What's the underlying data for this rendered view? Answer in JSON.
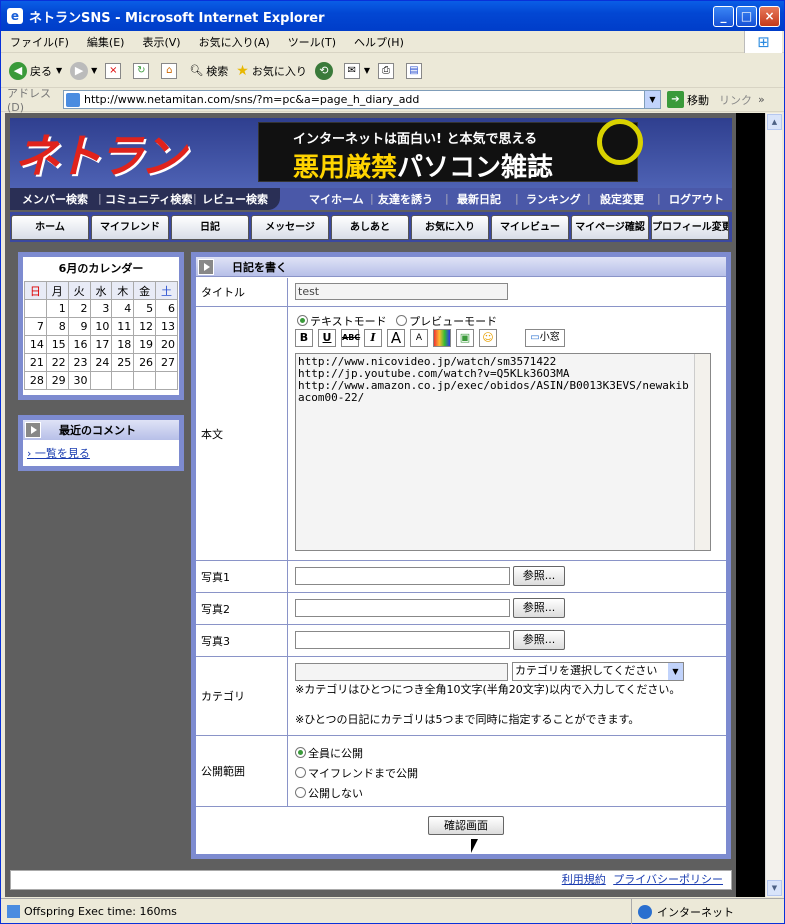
{
  "window": {
    "title": "ネトランSNS - Microsoft Internet Explorer"
  },
  "menu": [
    "ファイル(F)",
    "編集(E)",
    "表示(V)",
    "お気に入り(A)",
    "ツール(T)",
    "ヘルプ(H)"
  ],
  "toolbar": {
    "back": "戻る",
    "search": "検索",
    "favorites": "お気に入り"
  },
  "address": {
    "label": "アドレス(D)",
    "url": "http://www.netamitan.com/sns/?m=pc&a=page_h_diary_add",
    "go": "移動",
    "links": "リンク"
  },
  "site": {
    "logo": "ネトラン",
    "banner_line1": "インターネットは面白い! と本気で思える",
    "banner_line2a": "悪用厳禁",
    "banner_line2b": "パソコン雑誌"
  },
  "nav": {
    "left": [
      "メンバー検索",
      "コミュニティ検索",
      "レビュー検索"
    ],
    "right": [
      "マイホーム",
      "友達を誘う",
      "最新日記",
      "ランキング",
      "設定変更",
      "ログアウト"
    ]
  },
  "tabs": [
    "ホーム",
    "マイフレンド",
    "日記",
    "メッセージ",
    "あしあと",
    "お気に入り",
    "マイレビュー",
    "マイページ確認",
    "プロフィール変更"
  ],
  "calendar": {
    "title": "6月のカレンダー",
    "weekdays": [
      "日",
      "月",
      "火",
      "水",
      "木",
      "金",
      "土"
    ],
    "weeks": [
      [
        "",
        "1",
        "2",
        "3",
        "4",
        "5",
        "6",
        "7"
      ],
      [
        "8",
        "9",
        "10",
        "11",
        "12",
        "13",
        "14"
      ],
      [
        "15",
        "16",
        "17",
        "18",
        "19",
        "20",
        "21"
      ],
      [
        "22",
        "23",
        "24",
        "25",
        "26",
        "27",
        "28"
      ],
      [
        "29",
        "30",
        "",
        "",
        "",
        "",
        ""
      ]
    ]
  },
  "recent": {
    "title": "最近のコメント",
    "link": "一覧を見る"
  },
  "form": {
    "heading": "日記を書く",
    "title_label": "タイトル",
    "title_value": "test",
    "body_label": "本文",
    "mode_text": "テキストモード",
    "mode_preview": "プレビューモード",
    "small_window": "小窓",
    "body_text": "http://www.nicovideo.jp/watch/sm3571422\nhttp://jp.youtube.com/watch?v=Q5KLk36O3MA\nhttp://www.amazon.co.jp/exec/obidos/ASIN/B0013K3EVS/newakibacom00-22/",
    "photo1": "写真1",
    "photo2": "写真2",
    "photo3": "写真3",
    "browse": "参照...",
    "category_label": "カテゴリ",
    "category_select": "カテゴリを選択してください",
    "category_note1": "※カテゴリはひとつにつき全角10文字(半角20文字)以内で入力してください。",
    "category_note2": "※ひとつの日記にカテゴリは5つまで同時に指定することができます。",
    "scope_label": "公開範囲",
    "scope_all": "全員に公開",
    "scope_friends": "マイフレンドまで公開",
    "scope_none": "公開しない",
    "confirm": "確認画面"
  },
  "footer": {
    "terms": "利用規約",
    "privacy": "プライバシーポリシー"
  },
  "status": {
    "text": "Offspring Exec time: 160ms",
    "zone": "インターネット"
  }
}
